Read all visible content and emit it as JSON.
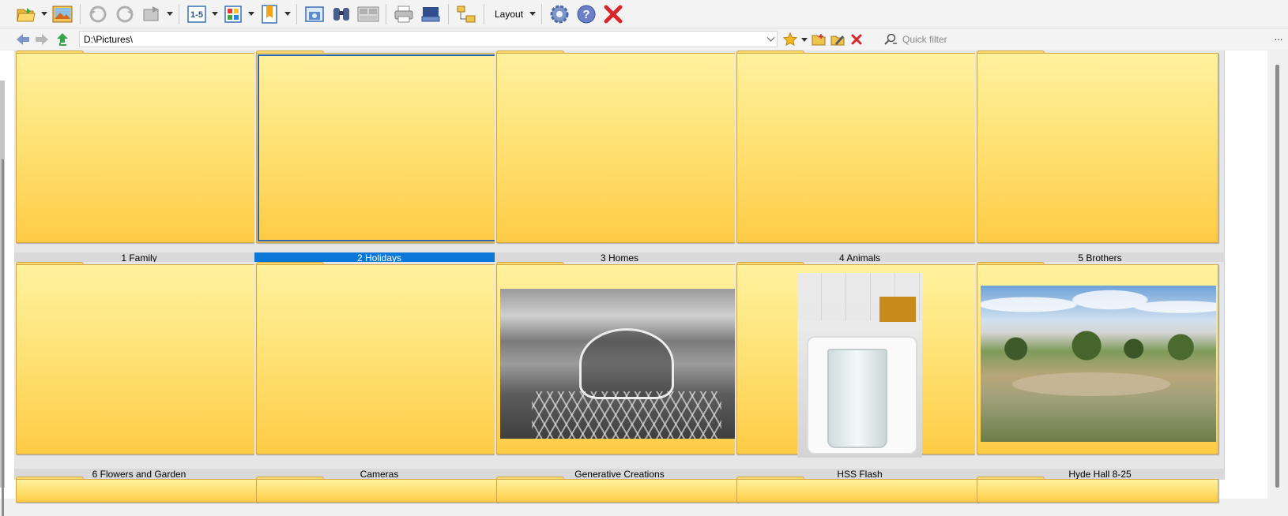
{
  "toolbar": {
    "layout_label": "Layout",
    "buttons": [
      {
        "name": "open-folder",
        "icon": "folder-open-icon"
      },
      {
        "name": "image-editor",
        "icon": "image-icon"
      },
      {
        "name": "rotate-left",
        "icon": "rotate-left-icon"
      },
      {
        "name": "rotate-right",
        "icon": "rotate-right-icon"
      },
      {
        "name": "transform",
        "icon": "transform-icon"
      },
      {
        "name": "rating",
        "icon": "rating-icon",
        "text": "1-5"
      },
      {
        "name": "color-labels",
        "icon": "color-grid-icon"
      },
      {
        "name": "bookmark",
        "icon": "bookmark-icon"
      },
      {
        "name": "screenshot",
        "icon": "camera-icon"
      },
      {
        "name": "find",
        "icon": "binoculars-icon"
      },
      {
        "name": "compare",
        "icon": "compare-icon"
      },
      {
        "name": "print",
        "icon": "printer-icon"
      },
      {
        "name": "scan",
        "icon": "scanner-icon"
      },
      {
        "name": "folder-tree",
        "icon": "folder-tree-icon"
      },
      {
        "name": "settings",
        "icon": "gear-icon"
      },
      {
        "name": "help",
        "icon": "help-icon"
      },
      {
        "name": "exit",
        "icon": "close-icon"
      }
    ],
    "rating_text": "1-5"
  },
  "address": {
    "path": "D:\\Pictures\\",
    "filter_placeholder": "Quick filter",
    "more": "..."
  },
  "grid": {
    "row1": [
      {
        "label": "1 Family",
        "selected": false,
        "thumb": "none"
      },
      {
        "label": "2 Holidays",
        "selected": true,
        "thumb": "none"
      },
      {
        "label": "3 Homes",
        "selected": false,
        "thumb": "none"
      },
      {
        "label": "4 Animals",
        "selected": false,
        "thumb": "none"
      },
      {
        "label": "5 Brothers",
        "selected": false,
        "thumb": "none"
      }
    ],
    "row2": [
      {
        "label": "6 Flowers and Garden",
        "selected": false,
        "thumb": "none"
      },
      {
        "label": "Cameras",
        "selected": false,
        "thumb": "none"
      },
      {
        "label": "Generative Creations",
        "selected": false,
        "thumb": "london-eye-bw"
      },
      {
        "label": "HSS Flash",
        "selected": false,
        "thumb": "water-glass"
      },
      {
        "label": "Hyde Hall 8-25",
        "selected": false,
        "thumb": "garden"
      }
    ]
  },
  "colors": {
    "folder_light": "#fff29e",
    "folder_dark": "#ffcb45",
    "selection": "#0b78d7",
    "close_red": "#d8262d"
  }
}
